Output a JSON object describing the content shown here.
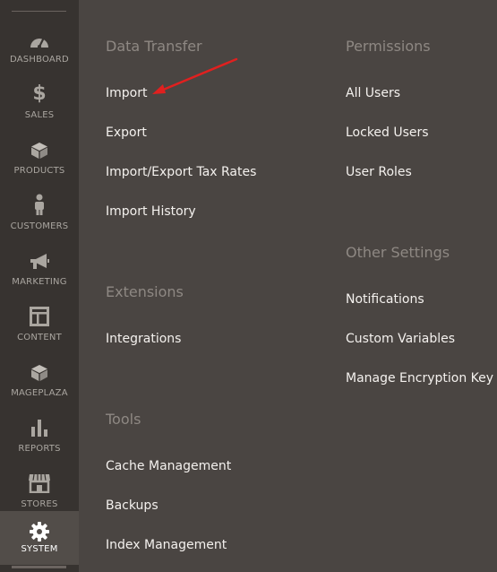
{
  "sidebar": {
    "items": [
      {
        "label": "DASHBOARD",
        "icon": "dashboard-icon"
      },
      {
        "label": "SALES",
        "icon": "dollar-icon"
      },
      {
        "label": "PRODUCTS",
        "icon": "cube-icon"
      },
      {
        "label": "CUSTOMERS",
        "icon": "person-icon"
      },
      {
        "label": "MARKETING",
        "icon": "megaphone-icon"
      },
      {
        "label": "CONTENT",
        "icon": "layout-icon"
      },
      {
        "label": "MAGEPLAZA",
        "icon": "cube-icon"
      },
      {
        "label": "REPORTS",
        "icon": "bar-chart-icon"
      },
      {
        "label": "STORES",
        "icon": "store-icon"
      },
      {
        "label": "SYSTEM",
        "icon": "gear-icon",
        "active": true
      }
    ]
  },
  "menu": {
    "data_transfer": {
      "title": "Data Transfer",
      "links": [
        "Import",
        "Export",
        "Import/Export Tax Rates",
        "Import History"
      ]
    },
    "extensions": {
      "title": "Extensions",
      "links": [
        "Integrations"
      ]
    },
    "tools": {
      "title": "Tools",
      "links": [
        "Cache Management",
        "Backups",
        "Index Management"
      ]
    },
    "permissions": {
      "title": "Permissions",
      "links": [
        "All Users",
        "Locked Users",
        "User Roles"
      ]
    },
    "other_settings": {
      "title": "Other Settings",
      "links": [
        "Notifications",
        "Custom Variables",
        "Manage Encryption Key"
      ]
    }
  },
  "colors": {
    "sidebar_bg": "#373330",
    "panel_bg": "#4a4542",
    "active_item_bg": "#524d49",
    "section_title": "#8e8883",
    "link_text": "#f4f1ee",
    "annotation_arrow": "#e0201f"
  }
}
